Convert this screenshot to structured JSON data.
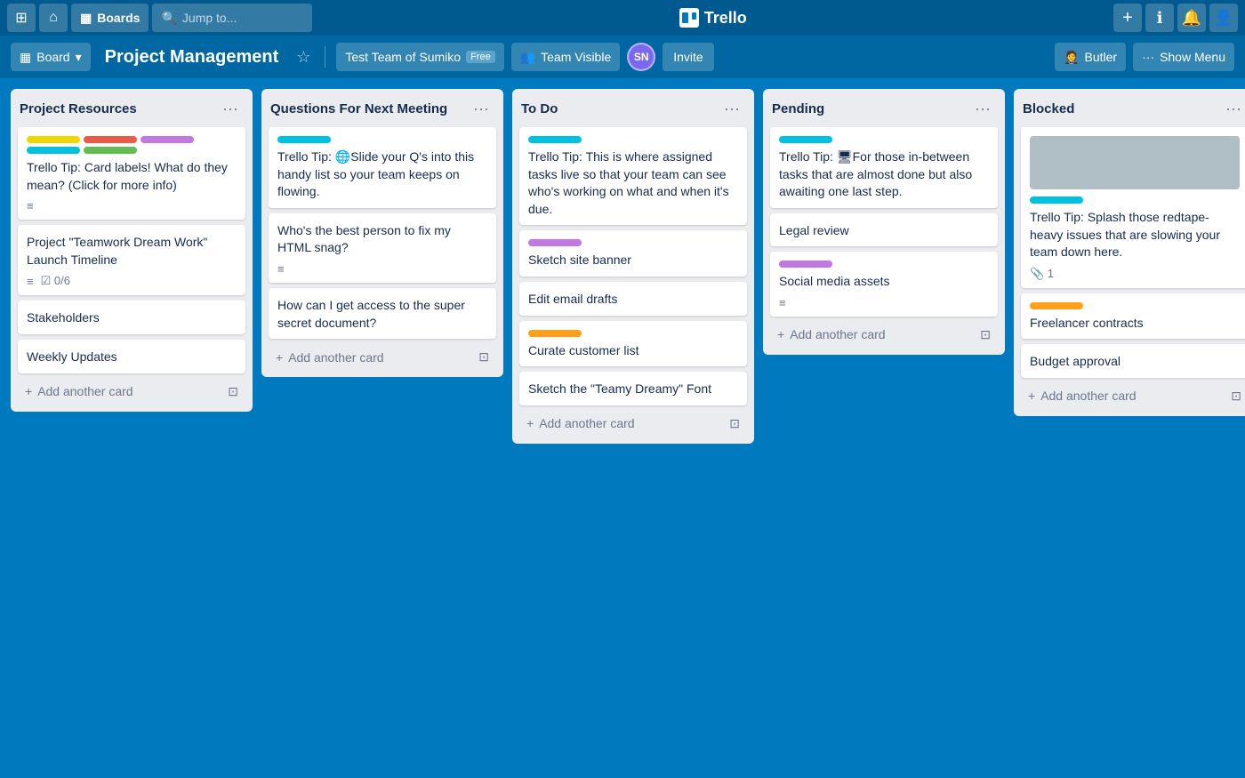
{
  "topnav": {
    "apps_icon": "⊞",
    "home_icon": "⌂",
    "boards_label": "Boards",
    "search_placeholder": "Jump to...",
    "search_icon": "🔍",
    "trello_label": "Trello",
    "add_icon": "+",
    "info_icon": "ℹ",
    "bell_icon": "🔔",
    "avatar_icon": "👤"
  },
  "boardheader": {
    "board_icon": "▦",
    "board_menu_label": "Board",
    "board_title": "Project Management",
    "star_icon": "☆",
    "team_label": "Test Team of Sumiko",
    "team_badge": "Free",
    "team_visible_icon": "👥",
    "team_visible_label": "Team Visible",
    "avatar_initials": "SN",
    "invite_label": "Invite",
    "butler_icon": "🤵",
    "butler_label": "Butler",
    "show_menu_icon": "···",
    "show_menu_label": "Show Menu"
  },
  "lists": [
    {
      "id": "project-resources",
      "title": "Project Resources",
      "cards": [
        {
          "id": "pr-1",
          "labels": [
            {
              "color": "yellow",
              "width": "wide"
            },
            {
              "color": "red",
              "width": "wide"
            },
            {
              "color": "purple",
              "width": "wide"
            },
            {
              "color": "teal",
              "width": "wide"
            },
            {
              "color": "green",
              "width": "wide"
            }
          ],
          "text": "Trello Tip: Card labels! What do they mean? (Click for more info)",
          "has_desc": true
        },
        {
          "id": "pr-2",
          "labels": [],
          "text": "Project \"Teamwork Dream Work\" Launch Timeline",
          "has_desc": true,
          "checklist": "0/6"
        },
        {
          "id": "pr-3",
          "labels": [],
          "text": "Stakeholders"
        },
        {
          "id": "pr-4",
          "labels": [],
          "text": "Weekly Updates"
        }
      ],
      "add_card_label": "Add another card"
    },
    {
      "id": "questions-next-meeting",
      "title": "Questions For Next Meeting",
      "cards": [
        {
          "id": "qm-1",
          "labels": [
            {
              "color": "teal",
              "width": "wide"
            }
          ],
          "text": "Trello Tip: 🌐Slide your Q's into this handy list so your team keeps on flowing."
        },
        {
          "id": "qm-2",
          "labels": [],
          "text": "Who's the best person to fix my HTML snag?",
          "has_desc": true
        },
        {
          "id": "qm-3",
          "labels": [],
          "text": "How can I get access to the super secret document?"
        }
      ],
      "add_card_label": "Add another card"
    },
    {
      "id": "to-do",
      "title": "To Do",
      "cards": [
        {
          "id": "td-1",
          "labels": [
            {
              "color": "teal",
              "width": "wide"
            }
          ],
          "text": "Trello Tip: This is where assigned tasks live so that your team can see who's working on what and when it's due."
        },
        {
          "id": "td-2",
          "labels": [
            {
              "color": "purple",
              "width": "wide"
            }
          ],
          "text": "Sketch site banner"
        },
        {
          "id": "td-3",
          "labels": [],
          "text": "Edit email drafts"
        },
        {
          "id": "td-4",
          "labels": [
            {
              "color": "orange",
              "width": "wide"
            }
          ],
          "text": "Curate customer list"
        },
        {
          "id": "td-5",
          "labels": [],
          "text": "Sketch the \"Teamy Dreamy\" Font"
        }
      ],
      "add_card_label": "Add another card"
    },
    {
      "id": "pending",
      "title": "Pending",
      "cards": [
        {
          "id": "pe-1",
          "labels": [
            {
              "color": "teal",
              "width": "wide"
            }
          ],
          "text": "Trello Tip: 🖥For those in-between tasks that are almost done but also awaiting one last step."
        },
        {
          "id": "pe-2",
          "labels": [],
          "text": "Legal review"
        },
        {
          "id": "pe-3",
          "labels": [
            {
              "color": "purple",
              "width": "wide"
            }
          ],
          "text": "Social media assets",
          "has_desc": true
        }
      ],
      "add_card_label": "Add another card"
    },
    {
      "id": "blocked",
      "title": "Blocked",
      "cards": [
        {
          "id": "bl-0",
          "is_image": true,
          "labels": [
            {
              "color": "teal",
              "width": "wide"
            }
          ],
          "text": "Trello Tip: Splash those redtape-heavy issues that are slowing your team down here.",
          "attachment_count": "1"
        },
        {
          "id": "bl-1",
          "labels": [
            {
              "color": "orange",
              "width": "wide"
            }
          ],
          "text": "Freelancer contracts"
        },
        {
          "id": "bl-2",
          "labels": [],
          "text": "Budget approval"
        }
      ],
      "add_card_label": "Add another card"
    }
  ],
  "label_colors": {
    "yellow": "#F2D600",
    "red": "#EB5A46",
    "purple": "#C377E0",
    "teal": "#00C2E0",
    "green": "#61BD4F",
    "blue": "#0079BF",
    "orange": "#FF9F1A"
  }
}
